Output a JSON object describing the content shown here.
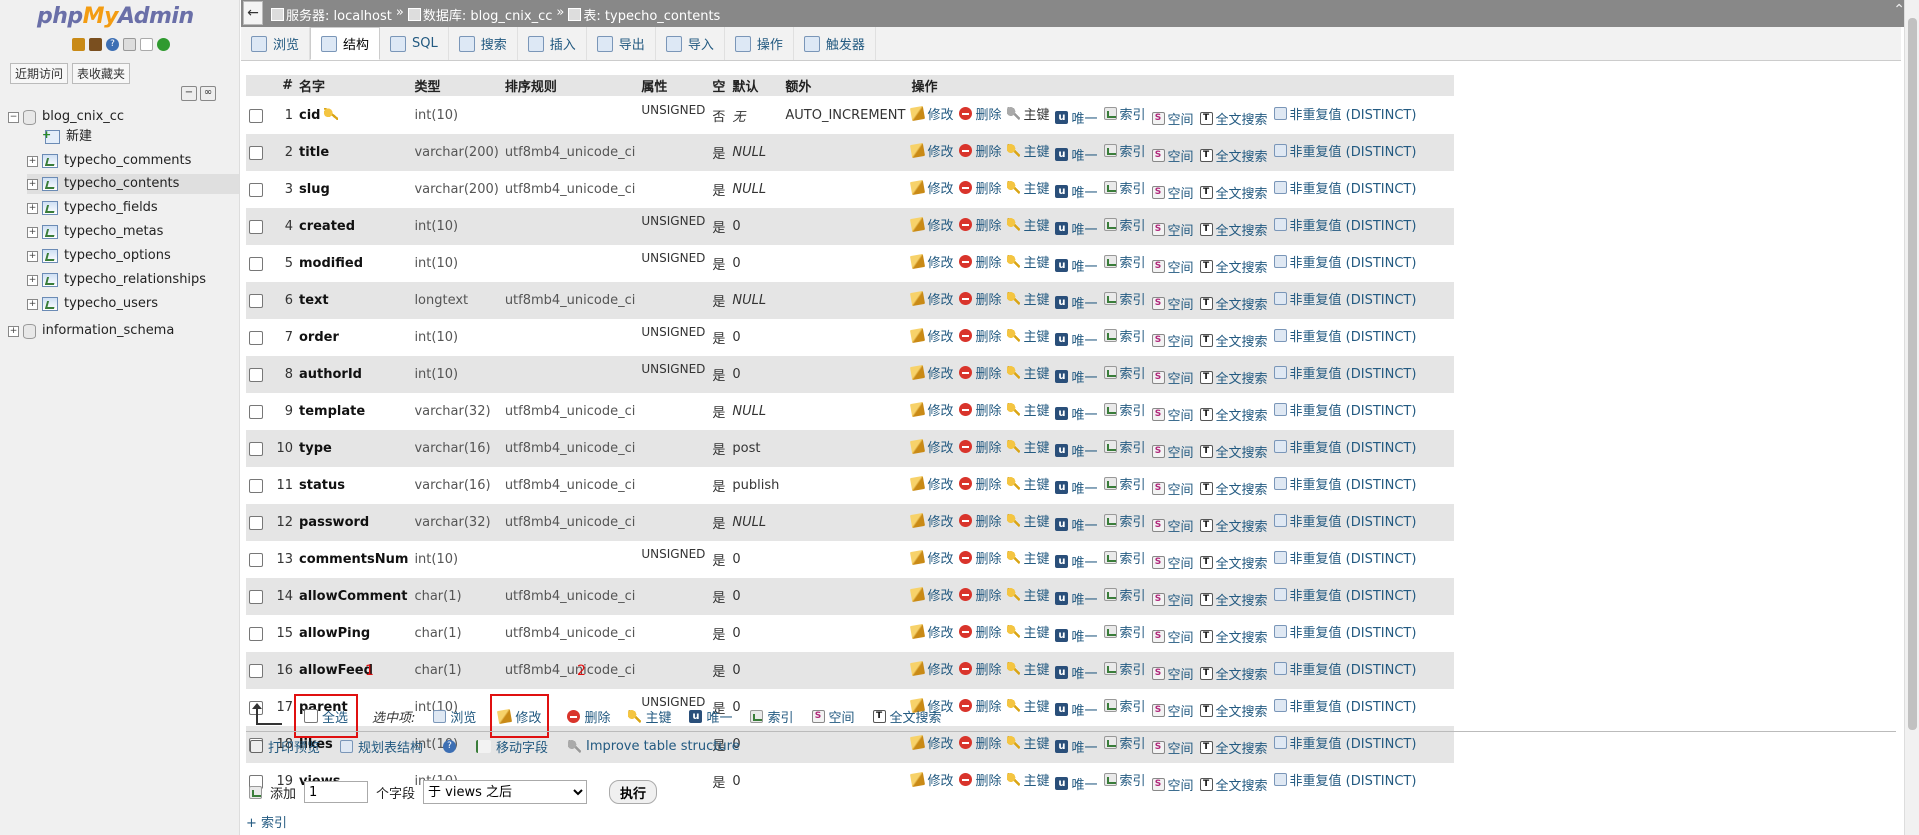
{
  "sidebar": {
    "logo": {
      "php": "php",
      "my": "My",
      "admin": "Admin"
    },
    "tabs": [
      "近期访问",
      "表收藏夹"
    ],
    "database": "blog_cnix_cc",
    "new_label": "新建",
    "tables": [
      "typecho_comments",
      "typecho_contents",
      "typecho_fields",
      "typecho_metas",
      "typecho_options",
      "typecho_relationships",
      "typecho_users"
    ],
    "selected_table": "typecho_contents",
    "other_db": "information_schema"
  },
  "topbar": {
    "server": "服务器: localhost",
    "database": "数据库: blog_cnix_cc",
    "table": "表: typecho_contents",
    "sep": "»"
  },
  "tabs": [
    {
      "label": "浏览",
      "icon": "browse-icon"
    },
    {
      "label": "结构",
      "icon": "structure-icon",
      "active": true
    },
    {
      "label": "SQL",
      "icon": "sql-icon"
    },
    {
      "label": "搜索",
      "icon": "search-icon"
    },
    {
      "label": "插入",
      "icon": "insert-icon"
    },
    {
      "label": "导出",
      "icon": "export-icon"
    },
    {
      "label": "导入",
      "icon": "import-icon"
    },
    {
      "label": "操作",
      "icon": "operations-icon"
    },
    {
      "label": "触发器",
      "icon": "triggers-icon"
    }
  ],
  "table": {
    "headers": [
      "#",
      "名字",
      "类型",
      "排序规则",
      "属性",
      "空",
      "默认",
      "额外",
      "操作"
    ],
    "actions": [
      "修改",
      "删除",
      "主键",
      "唯一",
      "索引",
      "空间",
      "全文搜索",
      "非重复值 (DISTINCT)"
    ],
    "rows": [
      {
        "n": "1",
        "name": "cid",
        "type": "int(10)",
        "collation": "",
        "attr": "UNSIGNED",
        "null": "否",
        "default": "无",
        "default_italic": true,
        "extra": "AUTO_INCREMENT",
        "primary": true
      },
      {
        "n": "2",
        "name": "title",
        "type": "varchar(200)",
        "collation": "utf8mb4_unicode_ci",
        "attr": "",
        "null": "是",
        "default": "NULL",
        "default_italic": true,
        "extra": ""
      },
      {
        "n": "3",
        "name": "slug",
        "type": "varchar(200)",
        "collation": "utf8mb4_unicode_ci",
        "attr": "",
        "null": "是",
        "default": "NULL",
        "default_italic": true,
        "extra": ""
      },
      {
        "n": "4",
        "name": "created",
        "type": "int(10)",
        "collation": "",
        "attr": "UNSIGNED",
        "null": "是",
        "default": "0",
        "extra": ""
      },
      {
        "n": "5",
        "name": "modified",
        "type": "int(10)",
        "collation": "",
        "attr": "UNSIGNED",
        "null": "是",
        "default": "0",
        "extra": ""
      },
      {
        "n": "6",
        "name": "text",
        "type": "longtext",
        "collation": "utf8mb4_unicode_ci",
        "attr": "",
        "null": "是",
        "default": "NULL",
        "default_italic": true,
        "extra": ""
      },
      {
        "n": "7",
        "name": "order",
        "type": "int(10)",
        "collation": "",
        "attr": "UNSIGNED",
        "null": "是",
        "default": "0",
        "extra": ""
      },
      {
        "n": "8",
        "name": "authorId",
        "type": "int(10)",
        "collation": "",
        "attr": "UNSIGNED",
        "null": "是",
        "default": "0",
        "extra": ""
      },
      {
        "n": "9",
        "name": "template",
        "type": "varchar(32)",
        "collation": "utf8mb4_unicode_ci",
        "attr": "",
        "null": "是",
        "default": "NULL",
        "default_italic": true,
        "extra": ""
      },
      {
        "n": "10",
        "name": "type",
        "type": "varchar(16)",
        "collation": "utf8mb4_unicode_ci",
        "attr": "",
        "null": "是",
        "default": "post",
        "extra": ""
      },
      {
        "n": "11",
        "name": "status",
        "type": "varchar(16)",
        "collation": "utf8mb4_unicode_ci",
        "attr": "",
        "null": "是",
        "default": "publish",
        "extra": ""
      },
      {
        "n": "12",
        "name": "password",
        "type": "varchar(32)",
        "collation": "utf8mb4_unicode_ci",
        "attr": "",
        "null": "是",
        "default": "NULL",
        "default_italic": true,
        "extra": ""
      },
      {
        "n": "13",
        "name": "commentsNum",
        "type": "int(10)",
        "collation": "",
        "attr": "UNSIGNED",
        "null": "是",
        "default": "0",
        "extra": ""
      },
      {
        "n": "14",
        "name": "allowComment",
        "type": "char(1)",
        "collation": "utf8mb4_unicode_ci",
        "attr": "",
        "null": "是",
        "default": "0",
        "extra": ""
      },
      {
        "n": "15",
        "name": "allowPing",
        "type": "char(1)",
        "collation": "utf8mb4_unicode_ci",
        "attr": "",
        "null": "是",
        "default": "0",
        "extra": ""
      },
      {
        "n": "16",
        "name": "allowFeed",
        "type": "char(1)",
        "collation": "utf8mb4_unicode_ci",
        "attr": "",
        "null": "是",
        "default": "0",
        "extra": ""
      },
      {
        "n": "17",
        "name": "parent",
        "type": "int(10)",
        "collation": "",
        "attr": "UNSIGNED",
        "null": "是",
        "default": "0",
        "extra": ""
      },
      {
        "n": "18",
        "name": "likes",
        "type": "int(10)",
        "collation": "",
        "attr": "",
        "null": "是",
        "default": "0",
        "extra": ""
      },
      {
        "n": "19",
        "name": "views",
        "type": "int(10)",
        "collation": "",
        "attr": "",
        "null": "是",
        "default": "0",
        "extra": ""
      }
    ]
  },
  "bulk": {
    "select_all": "全选",
    "with_selected": "选中项:",
    "items": [
      "浏览",
      "修改",
      "删除",
      "主键",
      "唯一",
      "索引",
      "空间",
      "全文搜索"
    ],
    "annotation_1": "1",
    "annotation_2": "2"
  },
  "tools": [
    "打印预览",
    "规划表结构",
    "移动字段",
    "Improve table structure"
  ],
  "add_field": {
    "label": "添加",
    "count": "1",
    "unit": "个字段",
    "position": "于 views 之后",
    "go": "执行"
  },
  "index_link": "+ 索引",
  "colors": {
    "link": "#235a81",
    "header_bg": "#e5e5e5",
    "topbar": "#888888",
    "annotation": "#e01010"
  }
}
